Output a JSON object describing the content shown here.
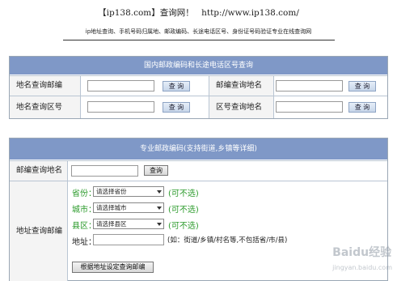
{
  "header": {
    "title": "【ip138.com】查询网！",
    "url": "http://www.ip138.com/",
    "subtitle": "ip地址查询、手机号码归属地、邮政编码、长途电话区号、身份证号码验证专业在线查询网"
  },
  "panel1": {
    "heading": "国内邮政编码和长途电话区号查询",
    "rows": [
      {
        "left_label": "地名查询邮编",
        "left_btn": "查 询",
        "right_label": "邮编查询地名",
        "right_btn": "查 询"
      },
      {
        "left_label": "地名查询区号",
        "left_btn": "查 询",
        "right_label": "区号查询地名",
        "right_btn": "查 询"
      }
    ]
  },
  "panel2": {
    "heading": "专业邮政编码(支持街道,乡镇等详细)",
    "lookup_label": "邮编查询地名",
    "lookup_btn": "查询",
    "addr_label": "地址查询邮编",
    "province_label": "省份：",
    "province_value": "请选择省份",
    "city_label": "城市：",
    "city_value": "请选择城市",
    "county_label": "县区：",
    "county_value": "请选择县区",
    "optional": "(可不选)",
    "address_label": "地址：",
    "address_hint": "(如：街道/乡镇/村名等,不包括省/市/县)",
    "submit_btn": "根据地址设定查询邮编"
  },
  "watermark": {
    "text": "Baidu经验",
    "sub": "jingyan.baidu.com"
  }
}
